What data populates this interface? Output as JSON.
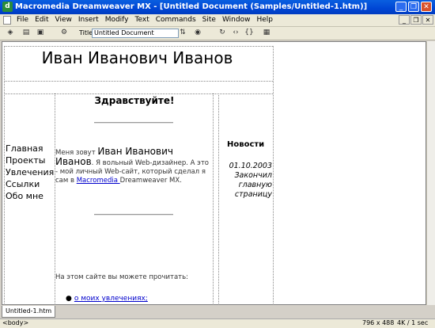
{
  "window": {
    "title": "Macromedia Dreamweaver MX - [Untitled Document (Samples/Untitled-1.htm)]",
    "app_icon": "dw-logo-icon"
  },
  "menu": {
    "items": [
      "File",
      "Edit",
      "View",
      "Insert",
      "Modify",
      "Text",
      "Commands",
      "Site",
      "Window",
      "Help"
    ]
  },
  "toolbar": {
    "title_label": "Title:",
    "title_value": "Untitled Document"
  },
  "document": {
    "header": "Иван Иванович Иванов",
    "nav": [
      "Главная",
      "Проекты",
      "Увлечения",
      "Ссылки",
      "Обо мне"
    ],
    "greeting": "Здравствуйте!",
    "intro": {
      "prefix": "Меня зовут ",
      "name": "Иван Иванович Иванов",
      "middle": ". Я вольный Web-дизайнер. А это - мой личный Web-сайт, который сделал я сам в ",
      "link": "Macromedia ",
      "suffix": "Dreamweaver MX."
    },
    "read_text": "На этом сайте вы можете прочитать:",
    "bullet_link": "о моих увлечениях;",
    "news": {
      "title": "Новости",
      "date": "01.10.2003",
      "lines": [
        "Закончил",
        "главную",
        "страницу"
      ]
    }
  },
  "tab": {
    "label": "Untitled-1.htm"
  },
  "status": {
    "tag": "<body>",
    "window_size": "796 x 488",
    "file_info": "4K / 1 sec"
  }
}
